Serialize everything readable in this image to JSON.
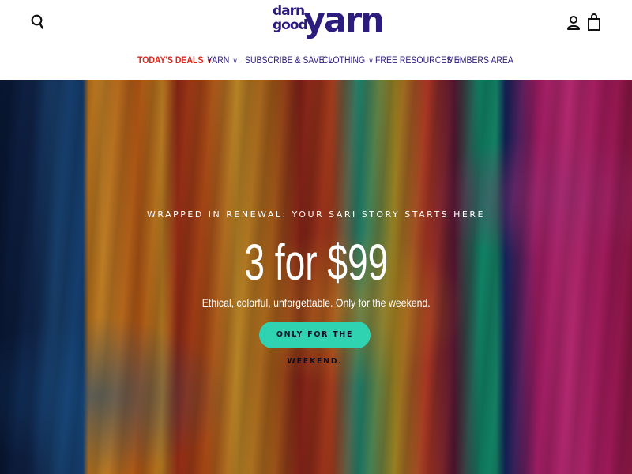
{
  "header": {
    "logo": {
      "small": [
        "darn",
        "good"
      ],
      "big": "yarn"
    },
    "icons": {
      "search": "search-icon",
      "account": "account-icon",
      "cart": "shopping-bag-icon"
    }
  },
  "nav": {
    "items": [
      {
        "label": "TODAY'S DEALS",
        "has_dropdown": true,
        "highlight": true
      },
      {
        "label": "YARN",
        "has_dropdown": true
      },
      {
        "label": "SUBSCRIBE & SAVE",
        "has_dropdown": true
      },
      {
        "label": "CLOTHING",
        "has_dropdown": true
      },
      {
        "label": "FREE RESOURCES",
        "has_dropdown": true
      },
      {
        "label": "MEMBERS AREA",
        "has_dropdown": false
      }
    ],
    "chevron": "v"
  },
  "hero": {
    "eyebrow": "WRAPPED IN RENEWAL: YOUR SARI STORY STARTS HERE",
    "headline": "3 for $99",
    "subtitle": "Ethical, colorful, unforgettable. Only for the weekend.",
    "cta_label": "ONLY FOR THE WEEKEND.",
    "background": "colorful embroidered sari patchwork textiles"
  },
  "colors": {
    "brand": "#2b1c7e",
    "deal": "#e0261b",
    "cta": "#2fd3b2",
    "hero_text": "#ffffff"
  }
}
